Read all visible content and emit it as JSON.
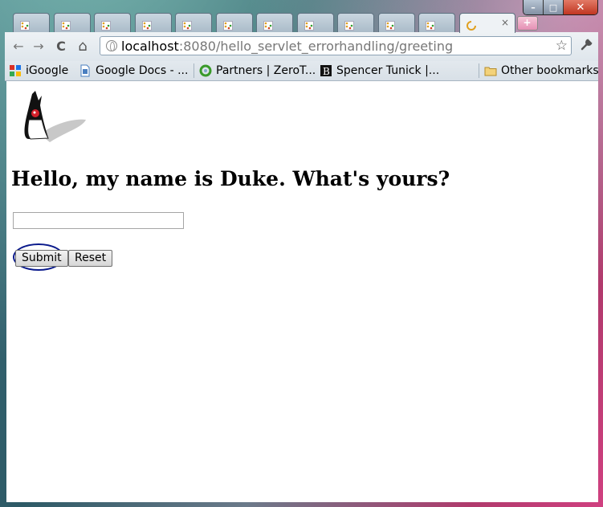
{
  "window": {
    "controls": {
      "minimize": "–",
      "maximize": "□",
      "close": "✕"
    }
  },
  "tabs": {
    "count_inactive": 11,
    "active_close": "×",
    "new_tab": "+"
  },
  "toolbar": {
    "back": "←",
    "forward": "→",
    "reload": "C",
    "home": "⌂",
    "url_host": "localhost",
    "url_rest": ":8080/hello_servlet_errorhandling/greeting",
    "star": "☆",
    "wrench": "🔧"
  },
  "bookmarks": {
    "items": [
      {
        "label": "iGoogle",
        "icon": "google-icon"
      },
      {
        "label": "Google Docs - ...",
        "icon": "docs-icon"
      },
      {
        "label": "Partners | ZeroT...",
        "icon": "partners-icon"
      },
      {
        "label": "Spencer Tunick |...",
        "icon": "spencer-icon"
      }
    ],
    "other": "Other bookmarks"
  },
  "page": {
    "heading": "Hello, my name is Duke. What's yours?",
    "name_input_value": "",
    "submit_label": "Submit",
    "reset_label": "Reset"
  },
  "colors": {
    "highlight_ring": "#0a1a8c",
    "frame_teal": "#2d5a66",
    "frame_pink": "#d04080"
  }
}
